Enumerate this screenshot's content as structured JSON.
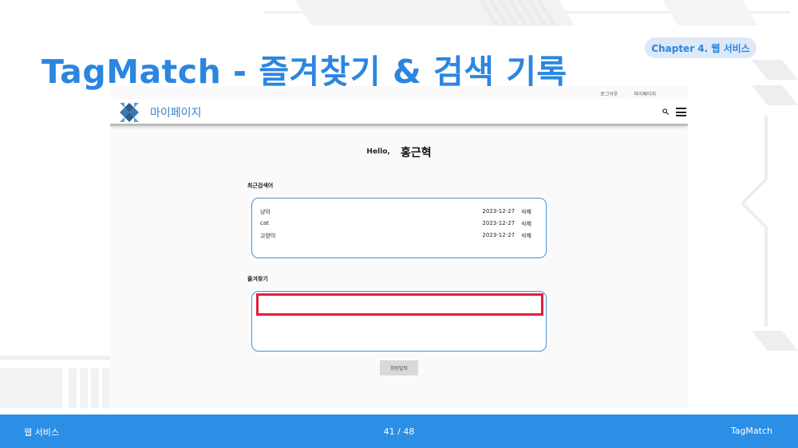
{
  "slide": {
    "title": "TagMatch - 즐겨찾기 & 검색 기록",
    "chapter": "Chapter 4. 웹 서비스"
  },
  "site": {
    "top_links": [
      "로그아웃",
      "마이페이지"
    ],
    "page_heading": "마이페이지",
    "hello_label": "Hello,",
    "user_name": "홍근혁",
    "recent_title": "최근검색어",
    "recent_searches": [
      {
        "term": "냥이",
        "date": "2023-12-27",
        "action": "삭제"
      },
      {
        "term": "cat",
        "date": "2023-12-27",
        "action": "삭제"
      },
      {
        "term": "고양이",
        "date": "2023-12-27",
        "action": "삭제"
      }
    ],
    "favorites_title": "즐겨찾기",
    "withdraw_label": "회원탈퇴"
  },
  "footer": {
    "left": "웹 서비스",
    "page": "41 / 48",
    "right": "TagMatch"
  },
  "colors": {
    "accent": "#2b86e0",
    "footer": "#2b8fe6",
    "highlight": "#e01e3c",
    "box_border": "#4a90d9"
  },
  "icons": [
    "logo-icon",
    "search-icon",
    "hamburger-menu-icon"
  ]
}
